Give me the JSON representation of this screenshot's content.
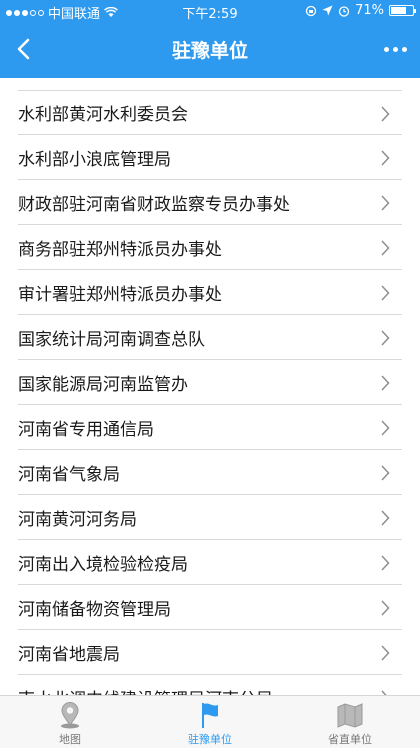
{
  "status_bar": {
    "carrier": "中国联通",
    "time": "下午2:59",
    "battery": "71%",
    "battery_level": 0.71
  },
  "nav": {
    "title": "驻豫单位",
    "back_icon": "chevron-left-icon",
    "more_icon": "more-dots-icon"
  },
  "list": {
    "items": [
      {
        "label": "水利部黄河水利委员会"
      },
      {
        "label": "水利部小浪底管理局"
      },
      {
        "label": "财政部驻河南省财政监察专员办事处"
      },
      {
        "label": "商务部驻郑州特派员办事处"
      },
      {
        "label": "审计署驻郑州特派员办事处"
      },
      {
        "label": "国家统计局河南调查总队"
      },
      {
        "label": "国家能源局河南监管办"
      },
      {
        "label": "河南省专用通信局"
      },
      {
        "label": "河南省气象局"
      },
      {
        "label": "河南黄河河务局"
      },
      {
        "label": "河南出入境检验检疫局"
      },
      {
        "label": "河南储备物资管理局"
      },
      {
        "label": "河南省地震局"
      },
      {
        "label": "南水北调中线建设管理局河南分局"
      }
    ]
  },
  "tabbar": {
    "active_color": "#2d9af0",
    "tabs": [
      {
        "label": "地图",
        "icon": "map-pin-icon"
      },
      {
        "label": "驻豫单位",
        "icon": "flag-icon"
      },
      {
        "label": "省直单位",
        "icon": "folded-map-icon"
      }
    ]
  }
}
